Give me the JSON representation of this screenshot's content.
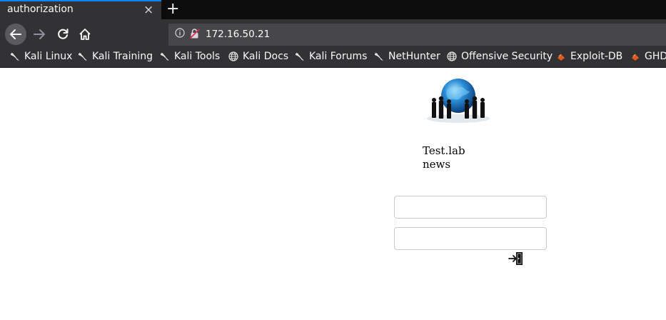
{
  "browser": {
    "tab_title": "authorization",
    "tab_close": "×",
    "new_tab": "+",
    "url": "172.16.50.21",
    "bookmarks": [
      {
        "label": "Kali Linux",
        "icon": "kali-dragon-icon"
      },
      {
        "label": "Kali Training",
        "icon": "kali-dragon-icon"
      },
      {
        "label": "Kali Tools",
        "icon": "kali-dragon-icon"
      },
      {
        "label": "Kali Docs",
        "icon": "globe-icon"
      },
      {
        "label": "Kali Forums",
        "icon": "kali-dragon-icon"
      },
      {
        "label": "NetHunter",
        "icon": "kali-dragon-icon"
      },
      {
        "label": "Offensive Security",
        "icon": "globe-icon"
      },
      {
        "label": "Exploit-DB",
        "icon": "exploitdb-icon"
      },
      {
        "label": "GHDB",
        "icon": "exploitdb-icon"
      }
    ]
  },
  "page": {
    "site_title": "Test.lab news",
    "username_value": "",
    "password_value": ""
  },
  "colors": {
    "accent": "#0a84ff",
    "toolbar": "#323234",
    "exploitdb": "#e05a1f"
  }
}
